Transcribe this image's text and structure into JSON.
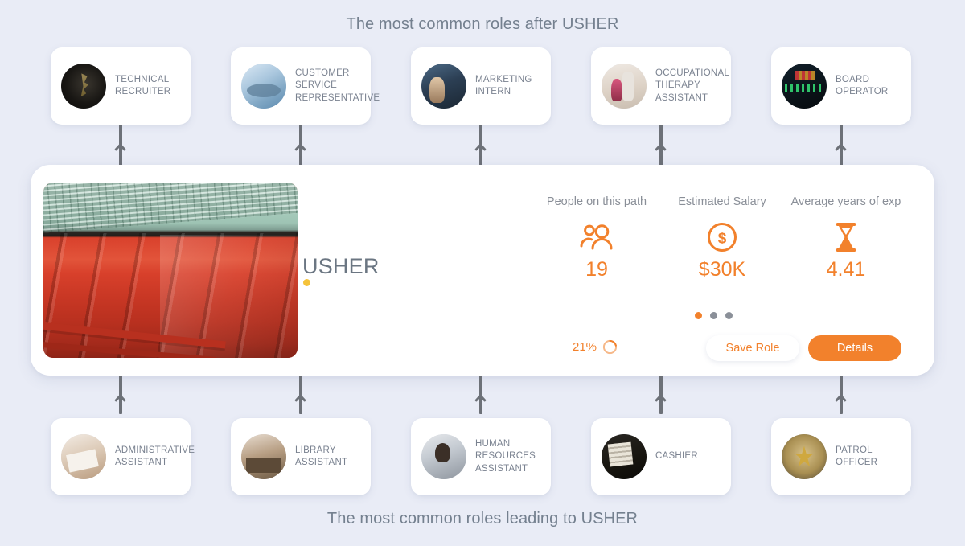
{
  "headings": {
    "top": "The most common roles after USHER",
    "bottom": "The most common roles leading to USHER"
  },
  "colors": {
    "background": "#e9ecf6",
    "accent": "#f2812c",
    "card": "#ffffff",
    "text_muted": "#7a8290",
    "heading": "#74808f",
    "arrow": "#6d7178",
    "title_dot": "#f5c33b"
  },
  "next_roles": [
    {
      "label": "TECHNICAL RECRUITER",
      "thumb": "technical-recruiter-photo"
    },
    {
      "label": "CUSTOMER SERVICE REPRESENTATIVE",
      "thumb": "customer-service-representative-photo"
    },
    {
      "label": "MARKETING INTERN",
      "thumb": "marketing-intern-photo"
    },
    {
      "label": "OCCUPATIONAL THERAPY ASSISTANT",
      "thumb": "occupational-therapy-assistant-photo"
    },
    {
      "label": "BOARD OPERATOR",
      "thumb": "board-operator-photo"
    }
  ],
  "previous_roles": [
    {
      "label": "ADMINISTRATIVE ASSISTANT",
      "thumb": "administrative-assistant-photo"
    },
    {
      "label": "LIBRARY ASSISTANT",
      "thumb": "library-assistant-photo"
    },
    {
      "label": "HUMAN RESOURCES ASSISTANT",
      "thumb": "human-resources-assistant-photo"
    },
    {
      "label": "CASHIER",
      "thumb": "cashier-photo"
    },
    {
      "label": "PATROL OFFICER",
      "thumb": "patrol-officer-photo"
    }
  ],
  "hero": {
    "title": "USHER",
    "image_alt": "stadium-seats-photo",
    "stats": [
      {
        "label": "People on this path",
        "value": "19",
        "icon": "people-icon"
      },
      {
        "label": "Estimated Salary",
        "value": "$30K",
        "icon": "dollar-circle-icon"
      },
      {
        "label": "Average years of exp",
        "value": "4.41",
        "icon": "hourglass-icon"
      }
    ],
    "match": {
      "percent": "21%",
      "icon": "progress-ring-icon",
      "value": 21
    },
    "pager": {
      "count": 3,
      "active_index": 0
    },
    "buttons": {
      "save": "Save Role",
      "details": "Details"
    }
  }
}
